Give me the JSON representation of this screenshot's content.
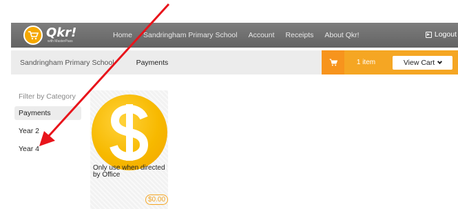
{
  "app": {
    "logo_name": "Qkr!",
    "logo_tagline": "with MasterPass"
  },
  "nav": {
    "items": [
      {
        "label": "Home"
      },
      {
        "label": "Sandringham Primary School"
      },
      {
        "label": "Account"
      },
      {
        "label": "Receipts"
      },
      {
        "label": "About Qkr!"
      }
    ],
    "logout_label": "Logout"
  },
  "breadcrumb": {
    "school": "Sandringham Primary School",
    "page": "Payments"
  },
  "cart": {
    "count_label": "1 item",
    "view_cart_label": "View Cart"
  },
  "sidebar": {
    "title": "Filter by Category",
    "items": [
      {
        "label": "Payments",
        "active": true
      },
      {
        "label": "Year 2",
        "active": false
      },
      {
        "label": "Year 4",
        "active": false
      }
    ]
  },
  "products": [
    {
      "name": "Only use when directed by Office",
      "price": "$0.00",
      "icon": "dollar-coin-icon"
    }
  ],
  "colors": {
    "accent": "#f5a623",
    "cart_icon_bg": "#f7941d",
    "nav_bg": "#6e6e6e",
    "annotation_arrow": "#e8141b"
  }
}
